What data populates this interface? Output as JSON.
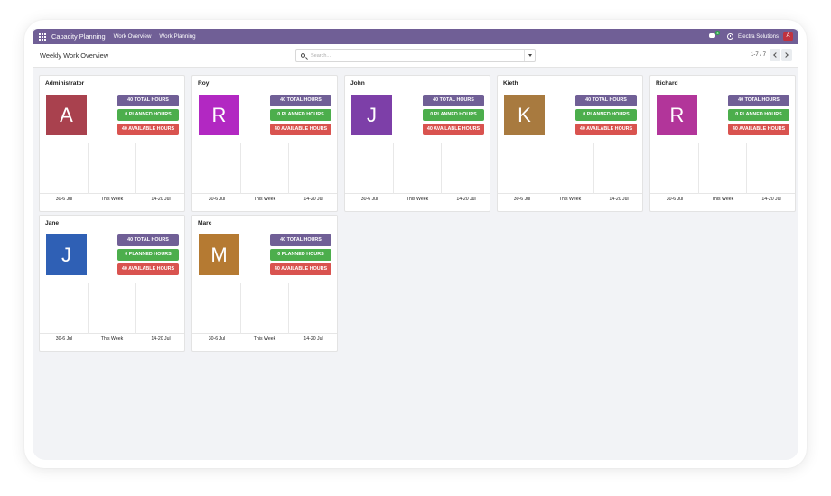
{
  "navbar": {
    "app_name": "Capacity Planning",
    "menu": [
      "Work Overview",
      "Work Planning"
    ],
    "chat_count": "4",
    "company": "Electra Solutions",
    "user_initial": "A",
    "color": "#705f96"
  },
  "control": {
    "title": "Weekly Work Overview",
    "search_placeholder": "Search...",
    "pager": "1-7 / 7"
  },
  "week_labels": [
    "30-6 Jul",
    "This Week",
    "14-20 Jul"
  ],
  "employees": [
    {
      "name": "Administrator",
      "initial": "A",
      "color": "#a9414e",
      "total": "40 TOTAL HOURS",
      "planned": "0 PLANNED HOURS",
      "available": "40 AVAILABLE HOURS"
    },
    {
      "name": "Roy",
      "initial": "R",
      "color": "#b228c2",
      "total": "40 TOTAL HOURS",
      "planned": "0 PLANNED HOURS",
      "available": "40 AVAILABLE HOURS"
    },
    {
      "name": "John",
      "initial": "J",
      "color": "#7d3fa8",
      "total": "40 TOTAL HOURS",
      "planned": "0 PLANNED HOURS",
      "available": "40 AVAILABLE HOURS"
    },
    {
      "name": "Kieth",
      "initial": "K",
      "color": "#a87a3f",
      "total": "40 TOTAL HOURS",
      "planned": "0 PLANNED HOURS",
      "available": "40 AVAILABLE HOURS"
    },
    {
      "name": "Richard",
      "initial": "R",
      "color": "#b2359a",
      "total": "40 TOTAL HOURS",
      "planned": "0 PLANNED HOURS",
      "available": "40 AVAILABLE HOURS"
    },
    {
      "name": "Jane",
      "initial": "J",
      "color": "#2f60b5",
      "total": "40 TOTAL HOURS",
      "planned": "0 PLANNED HOURS",
      "available": "40 AVAILABLE HOURS"
    },
    {
      "name": "Marc",
      "initial": "M",
      "color": "#b57a32",
      "total": "40 TOTAL HOURS",
      "planned": "0 PLANNED HOURS",
      "available": "40 AVAILABLE HOURS"
    }
  ]
}
